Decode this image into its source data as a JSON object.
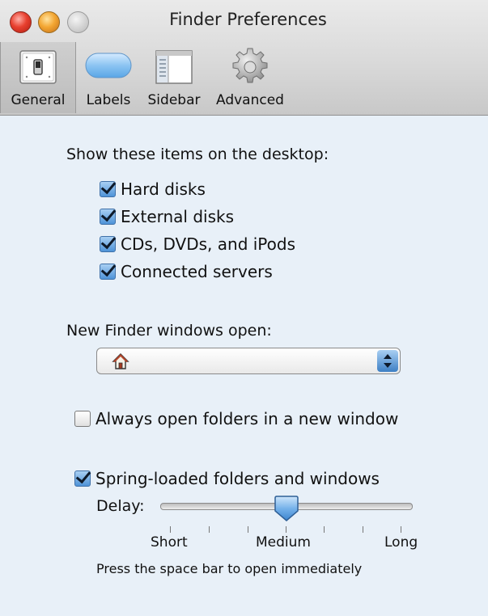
{
  "window": {
    "title": "Finder Preferences"
  },
  "toolbar": {
    "tabs": [
      {
        "label": "General",
        "icon": "light-switch-icon",
        "selected": true
      },
      {
        "label": "Labels",
        "icon": "label-pill-icon",
        "selected": false
      },
      {
        "label": "Sidebar",
        "icon": "sidebar-window-icon",
        "selected": false
      },
      {
        "label": "Advanced",
        "icon": "gear-icon",
        "selected": false
      }
    ]
  },
  "desktop": {
    "heading": "Show these items on the desktop:",
    "items": [
      {
        "label": "Hard disks",
        "checked": true
      },
      {
        "label": "External disks",
        "checked": true
      },
      {
        "label": "CDs, DVDs, and iPods",
        "checked": true
      },
      {
        "label": "Connected servers",
        "checked": true
      }
    ]
  },
  "new_windows": {
    "heading": "New Finder windows open:",
    "selected_icon": "home-icon",
    "selected_value": ""
  },
  "always_open": {
    "label": "Always open folders in a new window",
    "checked": false
  },
  "spring_loaded": {
    "label": "Spring-loaded folders and windows",
    "checked": true,
    "delay_label": "Delay:",
    "tick_labels": [
      "Short",
      "Medium",
      "Long"
    ],
    "value_fraction": 0.5,
    "note": "Press the space bar to open immediately"
  },
  "colors": {
    "content_background": "#e8f0f8",
    "accent_blue": "#4f93d8",
    "close_red": "#e8402f",
    "minimize_yellow": "#f3a632"
  }
}
